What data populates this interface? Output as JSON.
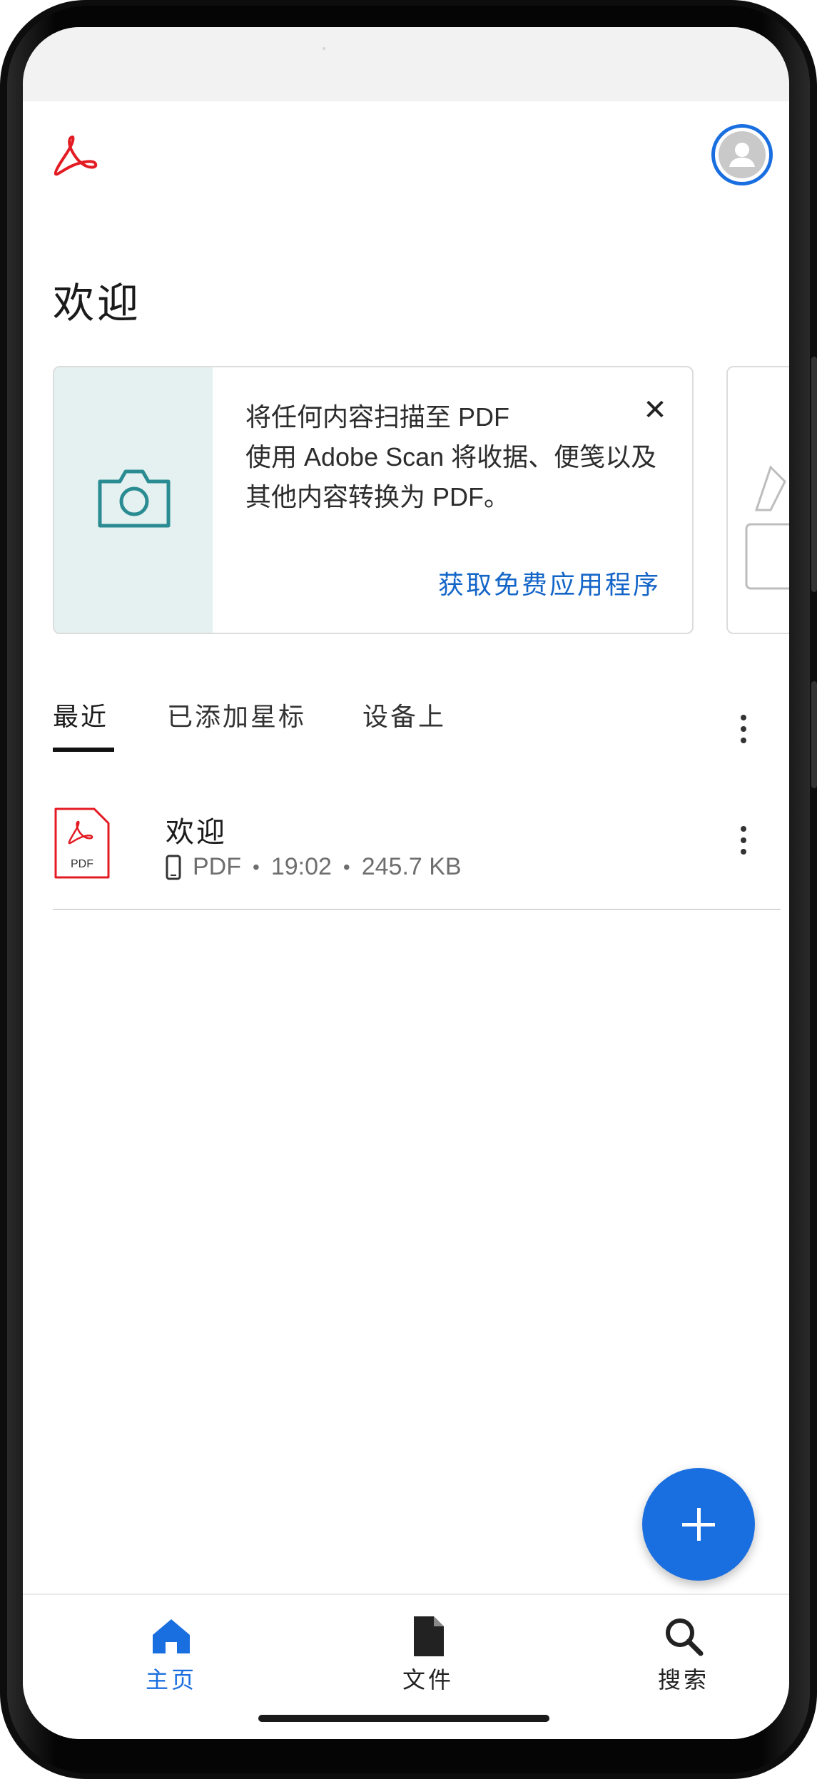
{
  "header": {
    "logo_icon": "adobe-acrobat-icon",
    "avatar_icon": "user-avatar-icon",
    "accent_color": "#1a6fe0",
    "brand_color": "#e31b23"
  },
  "main": {
    "title": "欢迎",
    "promo": {
      "heading": "将任何内容扫描至 PDF",
      "body": "使用 Adobe Scan 将收据、便笺以及其他内容转换为 PDF。",
      "link": "获取免费应用程序",
      "close_icon": "close-icon",
      "close_label": "✕",
      "media_icon": "camera-icon"
    },
    "tabs": [
      {
        "label": "最近",
        "active": true
      },
      {
        "label": "已添加星标",
        "active": false
      },
      {
        "label": "设备上",
        "active": false
      }
    ],
    "files": [
      {
        "name": "欢迎",
        "type_badge": "PDF",
        "location_icon": "phone-icon",
        "type": "PDF",
        "time": "19:02",
        "size": "245.7 KB"
      }
    ],
    "meta_separator": "•"
  },
  "fab": {
    "icon": "plus-icon"
  },
  "bottom_nav": {
    "items": [
      {
        "label": "主页",
        "icon": "home-icon",
        "active": true
      },
      {
        "label": "文件",
        "icon": "file-icon",
        "active": false
      },
      {
        "label": "搜索",
        "icon": "search-icon",
        "active": false
      }
    ]
  }
}
